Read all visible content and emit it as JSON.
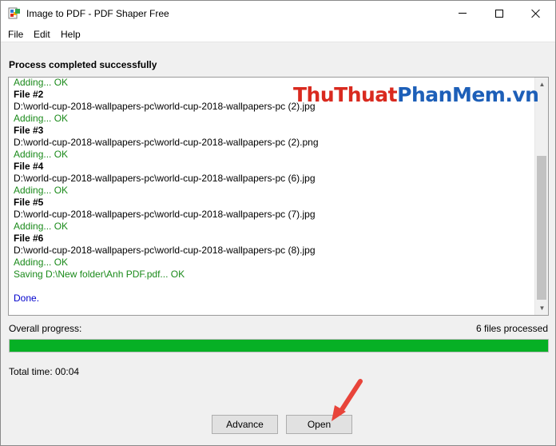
{
  "window": {
    "title": "Image to PDF - PDF Shaper Free",
    "app_icon": "pdf-shaper-app-icon",
    "controls": {
      "minimize": "minimize-icon",
      "maximize": "maximize-icon",
      "close": "close-icon"
    }
  },
  "menu": {
    "items": [
      {
        "label": "File"
      },
      {
        "label": "Edit"
      },
      {
        "label": "Help"
      }
    ]
  },
  "status_heading": "Process completed successfully",
  "log": {
    "lines": [
      {
        "text": "Adding... OK",
        "style": "green"
      },
      {
        "text": "File #2",
        "style": "bold"
      },
      {
        "text": "D:\\world-cup-2018-wallpapers-pc\\world-cup-2018-wallpapers-pc (2).jpg",
        "style": "black"
      },
      {
        "text": "Adding... OK",
        "style": "green"
      },
      {
        "text": "File #3",
        "style": "bold"
      },
      {
        "text": "D:\\world-cup-2018-wallpapers-pc\\world-cup-2018-wallpapers-pc (2).png",
        "style": "black"
      },
      {
        "text": "Adding... OK",
        "style": "green"
      },
      {
        "text": "File #4",
        "style": "bold"
      },
      {
        "text": "D:\\world-cup-2018-wallpapers-pc\\world-cup-2018-wallpapers-pc (6).jpg",
        "style": "black"
      },
      {
        "text": "Adding... OK",
        "style": "green"
      },
      {
        "text": "File #5",
        "style": "bold"
      },
      {
        "text": "D:\\world-cup-2018-wallpapers-pc\\world-cup-2018-wallpapers-pc (7).jpg",
        "style": "black"
      },
      {
        "text": "Adding... OK",
        "style": "green"
      },
      {
        "text": "File #6",
        "style": "bold"
      },
      {
        "text": "D:\\world-cup-2018-wallpapers-pc\\world-cup-2018-wallpapers-pc (8).jpg",
        "style": "black"
      },
      {
        "text": "Adding... OK",
        "style": "green"
      },
      {
        "text": "Saving D:\\New folder\\Anh PDF.pdf... OK",
        "style": "green"
      },
      {
        "text": "",
        "style": "black"
      },
      {
        "text": "Done.",
        "style": "blue"
      }
    ],
    "scroll_position": 0.67
  },
  "watermark": {
    "part1": "Thu",
    "part2": "Thuat",
    "part3": "Phan",
    "part4": "Mem",
    "part5": ".vn"
  },
  "progress": {
    "label": "Overall progress:",
    "count_text": "6 files processed",
    "value": 1.0,
    "color": "#06b025"
  },
  "total_time": "Total time: 00:04",
  "buttons": {
    "advance": "Advance",
    "open": "Open"
  },
  "annotation": {
    "arrow_color": "#e8443a"
  }
}
